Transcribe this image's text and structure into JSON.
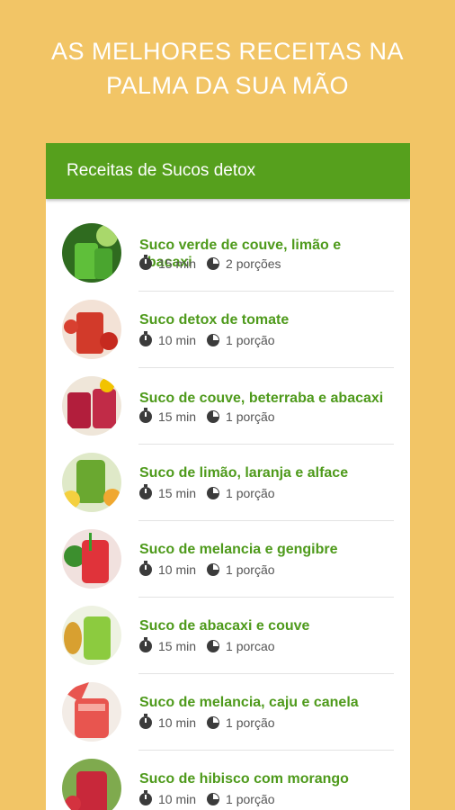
{
  "headline": {
    "line1": "AS MELHORES RECEITAS NA",
    "line2": "PALMA DA SUA MÃO"
  },
  "app": {
    "title": "Receitas de Sucos detox"
  },
  "recipes": [
    {
      "title": "Suco verde de couve, limão e abacaxi",
      "time": "15 min",
      "servings": "2 porções",
      "color": "#6BBE3A"
    },
    {
      "title": "Suco detox de tomate",
      "time": "10 min",
      "servings": "1 porção",
      "color": "#D23A2A"
    },
    {
      "title": "Suco de couve, beterraba e abacaxi",
      "time": "15 min",
      "servings": "1 porção",
      "color": "#B21E3C"
    },
    {
      "title": "Suco de limão, laranja e alface",
      "time": "15 min",
      "servings": "1 porção",
      "color": "#7DBA3A"
    },
    {
      "title": "Suco de melancia e gengibre",
      "time": "10 min",
      "servings": "1 porção",
      "color": "#E0333A"
    },
    {
      "title": "Suco de abacaxi e couve",
      "time": "15 min",
      "servings": "1 porcao",
      "color": "#8CCB3F"
    },
    {
      "title": "Suco de melancia, caju e canela",
      "time": "10 min",
      "servings": "1 porção",
      "color": "#E8554F"
    },
    {
      "title": "Suco de hibisco com morango",
      "time": "10 min",
      "servings": "1 porção",
      "color": "#C8283A"
    }
  ]
}
